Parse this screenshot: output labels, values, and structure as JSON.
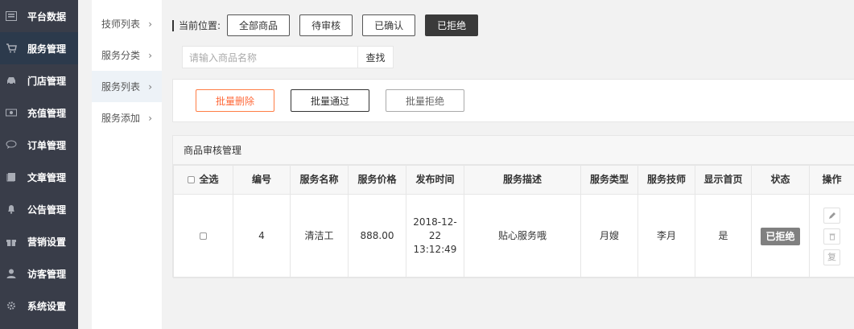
{
  "sidebar": {
    "items": [
      {
        "label": "平台数据",
        "icon": "dashboard-icon"
      },
      {
        "label": "服务管理",
        "icon": "cart-icon"
      },
      {
        "label": "门店管理",
        "icon": "car-icon"
      },
      {
        "label": "充值管理",
        "icon": "money-icon"
      },
      {
        "label": "订单管理",
        "icon": "chat-icon"
      },
      {
        "label": "文章管理",
        "icon": "book-icon"
      },
      {
        "label": "公告管理",
        "icon": "bell-icon"
      },
      {
        "label": "营销设置",
        "icon": "gift-icon"
      },
      {
        "label": "访客管理",
        "icon": "user-icon"
      },
      {
        "label": "系统设置",
        "icon": "gear-icon"
      }
    ],
    "active_index": 1
  },
  "subnav": {
    "items": [
      {
        "label": "技师列表"
      },
      {
        "label": "服务分类"
      },
      {
        "label": "服务列表"
      },
      {
        "label": "服务添加"
      }
    ],
    "active_index": 2
  },
  "filter": {
    "crumb_label": "当前位置:",
    "buttons": [
      {
        "label": "全部商品"
      },
      {
        "label": "待审核"
      },
      {
        "label": "已确认"
      },
      {
        "label": "已拒绝"
      }
    ],
    "active_index": 3
  },
  "search": {
    "placeholder": "请输入商品名称",
    "button_label": "查找"
  },
  "batch": {
    "delete_label": "批量删除",
    "pass_label": "批量通过",
    "reject_label": "批量拒绝"
  },
  "table": {
    "title": "商品审核管理",
    "select_all_label": "全选",
    "headers": [
      "编号",
      "服务名称",
      "服务价格",
      "发布时间",
      "服务描述",
      "服务类型",
      "服务技师",
      "显示首页",
      "状态",
      "操作"
    ],
    "rows": [
      {
        "id": "4",
        "name": "清洁工",
        "price": "888.00",
        "time_date": "2018-12-",
        "time_day": "22",
        "time_clock": "13:12:49",
        "desc": "贴心服务哦",
        "type": "月嫂",
        "tech": "李月",
        "homepage": "是",
        "status": "已拒绝",
        "ops": {
          "edit_icon": "pencil-icon",
          "delete_icon": "trash-icon",
          "restore_label": "复"
        }
      }
    ]
  },
  "colors": {
    "sidebar_bg": "#393d49",
    "sidebar_active": "#2c3a4c",
    "delete_accent": "#ff6a3a",
    "status_badge": "#808080"
  }
}
